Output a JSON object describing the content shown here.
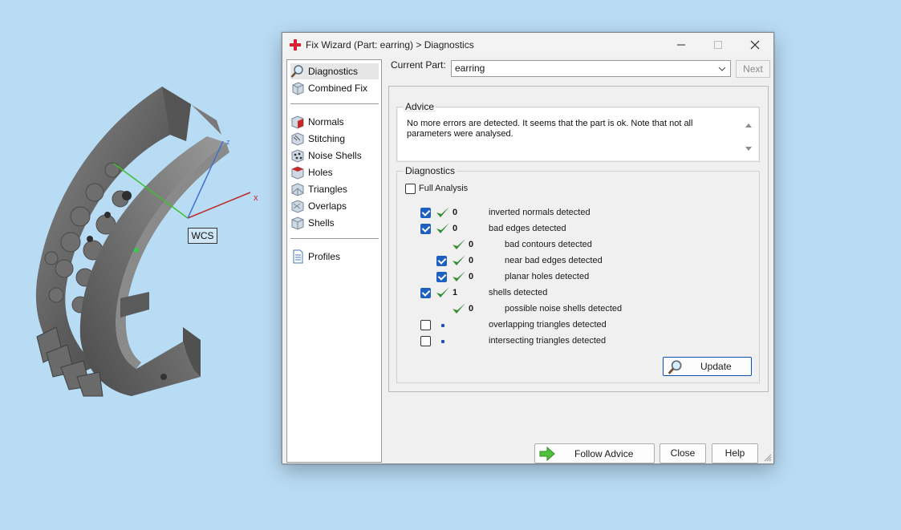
{
  "viewport": {
    "wcs_label": "WCS",
    "axis_x": "x",
    "axis_z": "z"
  },
  "window": {
    "title": "Fix Wizard (Part: earring) > Diagnostics",
    "minimize_icon": "minimize-icon",
    "maximize_icon": "maximize-icon",
    "close_icon": "close-icon"
  },
  "nav": {
    "items": [
      {
        "label": "Diagnostics",
        "icon": "magnifier-icon"
      },
      {
        "label": "Combined Fix",
        "icon": "combined-fix-icon"
      },
      {
        "label": "Normals",
        "icon": "normals-icon"
      },
      {
        "label": "Stitching",
        "icon": "stitching-icon"
      },
      {
        "label": "Noise Shells",
        "icon": "noise-shells-icon"
      },
      {
        "label": "Holes",
        "icon": "holes-icon"
      },
      {
        "label": "Triangles",
        "icon": "triangles-icon"
      },
      {
        "label": "Overlaps",
        "icon": "overlaps-icon"
      },
      {
        "label": "Shells",
        "icon": "shells-icon"
      },
      {
        "label": "Profiles",
        "icon": "document-icon"
      }
    ],
    "selected": "Diagnostics"
  },
  "current_part": {
    "label": "Current Part:",
    "value": "earring",
    "next_label": "Next"
  },
  "advice": {
    "title": "Advice",
    "text": "No more errors are detected. It seems that the part is ok. Note that not all parameters were analysed."
  },
  "diagnostics": {
    "title": "Diagnostics",
    "full_analysis_label": "Full Analysis",
    "full_analysis_checked": false,
    "rows": [
      {
        "checked": true,
        "status": "ok",
        "count": "0",
        "label": "inverted normals detected"
      },
      {
        "checked": true,
        "status": "ok",
        "count": "0",
        "label": "bad edges detected"
      },
      {
        "checked": null,
        "status": "ok",
        "count": "0",
        "label": "bad contours detected"
      },
      {
        "checked": true,
        "status": "ok",
        "count": "0",
        "label": "near bad edges detected"
      },
      {
        "checked": true,
        "status": "ok",
        "count": "0",
        "label": "planar holes detected"
      },
      {
        "checked": true,
        "status": "ok",
        "count": "1",
        "label": "shells detected"
      },
      {
        "checked": null,
        "status": "ok",
        "count": "0",
        "label": "possible noise shells detected"
      },
      {
        "checked": false,
        "status": "none",
        "count": "",
        "label": "overlapping triangles detected"
      },
      {
        "checked": false,
        "status": "none",
        "count": "",
        "label": "intersecting triangles detected"
      }
    ],
    "update_label": "Update"
  },
  "footer": {
    "follow_advice_label": "Follow Advice",
    "close_label": "Close",
    "help_label": "Help"
  },
  "colors": {
    "desktop": "#b9dcf5",
    "check_green": "#2e8b2e",
    "checkbox_blue": "#1e60c2",
    "model_gray": "#6b6b6b"
  }
}
